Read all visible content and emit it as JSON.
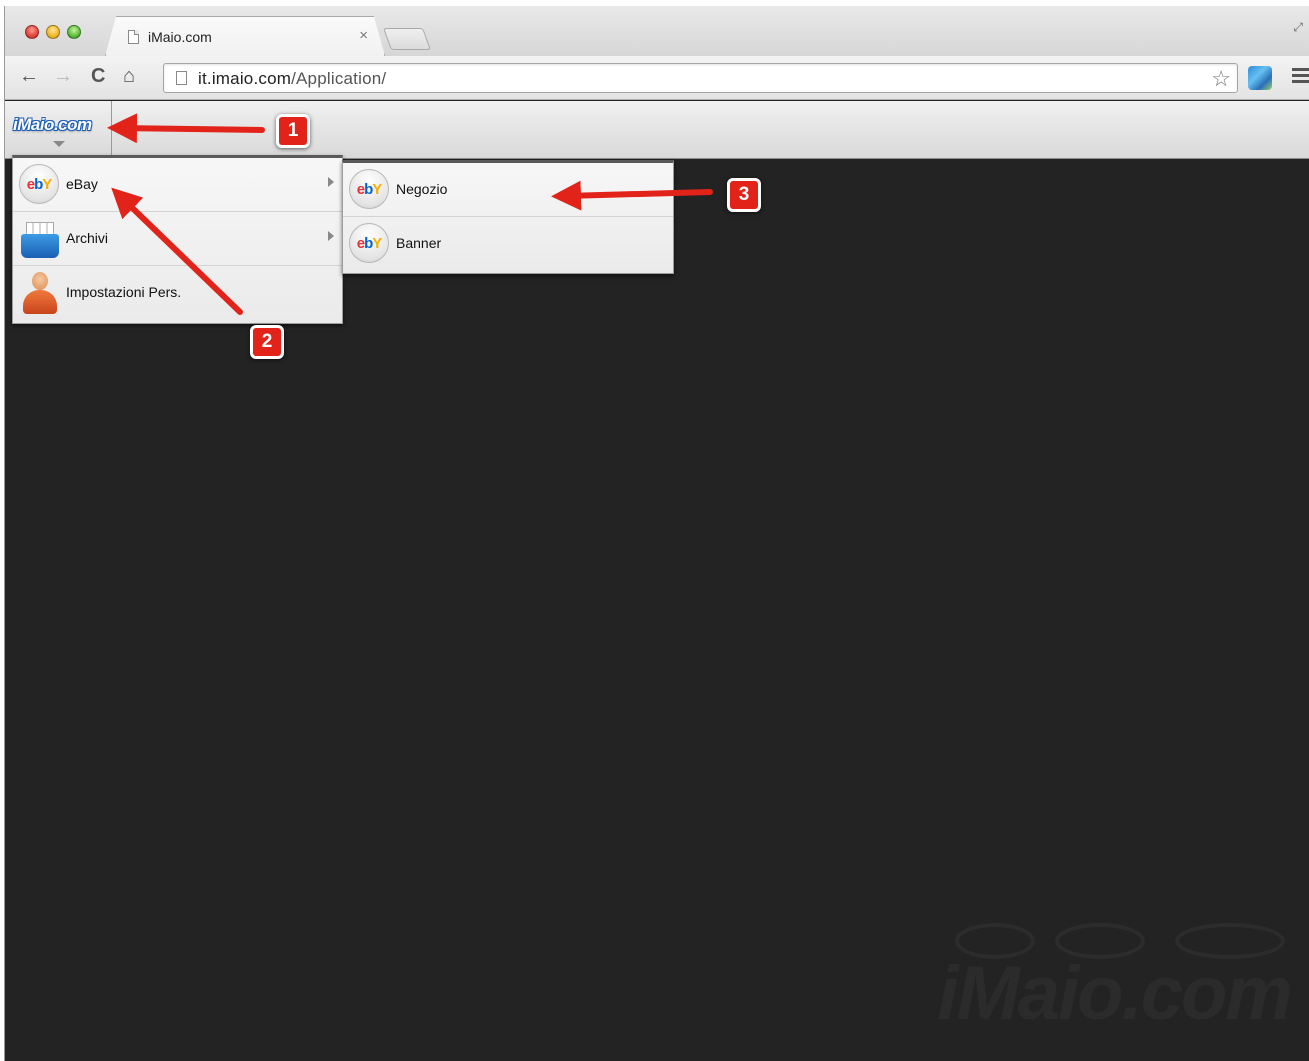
{
  "browser": {
    "tab_title": "iMaio.com",
    "tab_close": "×",
    "url_domain": "it.imaio.com",
    "url_path": "/Application/",
    "back_glyph": "←",
    "forward_glyph": "→",
    "reload_glyph": "C",
    "home_glyph": "⌂",
    "star_glyph": "☆",
    "fullscreen_glyph": "⤢"
  },
  "app": {
    "logo_text": "iMaio.com",
    "watermark_text": "iMaio.com"
  },
  "menu": {
    "items": [
      {
        "label": "eBay",
        "icon": "ebay-icon",
        "has_submenu": true
      },
      {
        "label": "Archivi",
        "icon": "archive-icon",
        "has_submenu": true
      },
      {
        "label": "Impostazioni Pers.",
        "icon": "user-icon",
        "has_submenu": false
      }
    ],
    "submenu": [
      {
        "label": "Negozio",
        "icon": "ebay-icon"
      },
      {
        "label": "Banner",
        "icon": "ebay-icon"
      }
    ],
    "ebay_letters": {
      "e": "e",
      "b": "b",
      "y": "Y"
    }
  },
  "annotations": {
    "badge_1": "1",
    "badge_2": "2",
    "badge_3": "3",
    "color": "#e2231a"
  }
}
